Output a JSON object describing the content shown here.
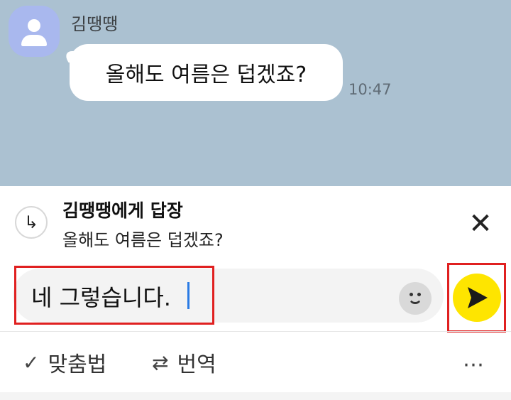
{
  "chat": {
    "sender_name": "김땡땡",
    "message_text": "올해도 여름은 덥겠죠?",
    "message_time": "10:47"
  },
  "reply": {
    "title": "김땡땡에게 답장",
    "preview": "올해도 여름은 덥겠죠?",
    "reply_icon": "↳",
    "close_icon": "✕"
  },
  "composer": {
    "input_value": "네 그렇습니다."
  },
  "toolbar": {
    "spellcheck_icon": "✓",
    "spellcheck_label": "맞춤법",
    "translate_icon": "⇄",
    "translate_label": "번역",
    "more_icon": "⋯"
  },
  "colors": {
    "chat_background": "#abc1d1",
    "send_button": "#fee500",
    "highlight": "#e02020"
  }
}
